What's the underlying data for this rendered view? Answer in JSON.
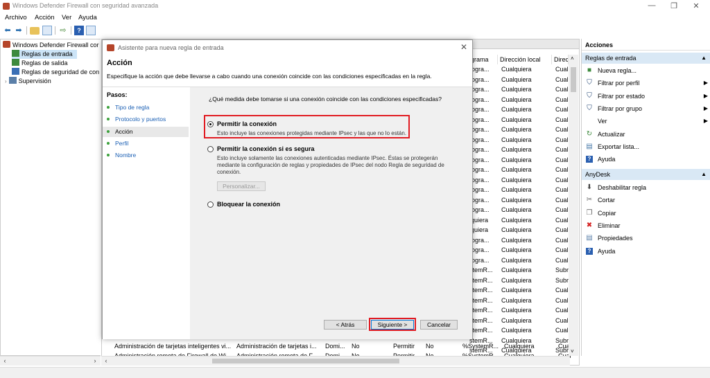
{
  "window": {
    "title": "Windows Defender Firewall con seguridad avanzada",
    "controls": [
      "—",
      "❐",
      "✕"
    ]
  },
  "menu": [
    "Archivo",
    "Acción",
    "Ver",
    "Ayuda"
  ],
  "toolbar": {
    "icons": [
      "back-arrow-icon",
      "forward-arrow-icon",
      "folder-up-icon",
      "view-icon",
      "export-icon",
      "help-icon",
      "properties-icon"
    ]
  },
  "tree": {
    "root": "Windows Defender Firewall cor",
    "items": [
      "Reglas de entrada",
      "Reglas de salida",
      "Reglas de seguridad de con",
      "Supervisión"
    ]
  },
  "list": {
    "columns": [
      "grama",
      "Dirección local",
      "Direc"
    ],
    "rows": [
      [
        "rogra...",
        "Cualquiera",
        "Cual"
      ],
      [
        "rogra...",
        "Cualquiera",
        "Cual"
      ],
      [
        "rogra...",
        "Cualquiera",
        "Cual"
      ],
      [
        "rogra...",
        "Cualquiera",
        "Cual"
      ],
      [
        "rogra...",
        "Cualquiera",
        "Cual"
      ],
      [
        "rogra...",
        "Cualquiera",
        "Cual"
      ],
      [
        "rogra...",
        "Cualquiera",
        "Cual"
      ],
      [
        "rogra...",
        "Cualquiera",
        "Cual"
      ],
      [
        "rogra...",
        "Cualquiera",
        "Cual"
      ],
      [
        "rogra...",
        "Cualquiera",
        "Cual"
      ],
      [
        "rogra...",
        "Cualquiera",
        "Cual"
      ],
      [
        "rogra...",
        "Cualquiera",
        "Cual"
      ],
      [
        "rogra...",
        "Cualquiera",
        "Cual"
      ],
      [
        "rogra...",
        "Cualquiera",
        "Cual"
      ],
      [
        "rogra...",
        "Cualquiera",
        "Cual"
      ],
      [
        "lquiera",
        "Cualquiera",
        "Cual"
      ],
      [
        "lquiera",
        "Cualquiera",
        "Cual"
      ],
      [
        "rogra...",
        "Cualquiera",
        "Cual"
      ],
      [
        "rogra...",
        "Cualquiera",
        "Cual"
      ],
      [
        "rogra...",
        "Cualquiera",
        "Cual"
      ],
      [
        "stemR...",
        "Cualquiera",
        "Subr"
      ],
      [
        "stemR...",
        "Cualquiera",
        "Subr"
      ],
      [
        "stemR...",
        "Cualquiera",
        "Cual"
      ],
      [
        "stemR...",
        "Cualquiera",
        "Cual"
      ],
      [
        "stemR...",
        "Cualquiera",
        "Cual"
      ],
      [
        "stemR...",
        "Cualquiera",
        "Cual"
      ],
      [
        "stemR...",
        "Cualquiera",
        "Cual"
      ],
      [
        "stemR...",
        "Cualquiera",
        "Subr"
      ],
      [
        "stemR...",
        "Cualquiera",
        "Subr"
      ]
    ],
    "bottom_rows": [
      [
        "Administración de tarjetas inteligentes vi...",
        "Administración de tarjetas i...",
        "Domi...",
        "No",
        "Permitir",
        "No",
        "%SystemR...",
        "Cualquiera",
        "Cual"
      ],
      [
        "Administración remota de Firewall de Wi...",
        "Administración remota de F...",
        "Domi...",
        "No",
        "Permitir",
        "No",
        "%SystemR...",
        "Cualquiera",
        "Cual"
      ]
    ]
  },
  "actions": {
    "title": "Acciones",
    "section1": {
      "title": "Reglas de entrada",
      "items": [
        {
          "icon": "new-rule-icon",
          "label": "Nueva regla...",
          "submenu": false
        },
        {
          "icon": "filter-icon",
          "label": "Filtrar por perfil",
          "submenu": true
        },
        {
          "icon": "filter-icon",
          "label": "Filtrar por estado",
          "submenu": true
        },
        {
          "icon": "filter-icon",
          "label": "Filtrar por grupo",
          "submenu": true
        },
        {
          "icon": "view-icon",
          "label": "Ver",
          "submenu": true
        },
        {
          "icon": "refresh-icon",
          "label": "Actualizar",
          "submenu": false
        },
        {
          "icon": "export-icon",
          "label": "Exportar lista...",
          "submenu": false
        },
        {
          "icon": "help-icon",
          "label": "Ayuda",
          "submenu": false
        }
      ]
    },
    "section2": {
      "title": "AnyDesk",
      "items": [
        {
          "icon": "disable-icon",
          "label": "Deshabilitar regla"
        },
        {
          "icon": "cut-icon",
          "label": "Cortar"
        },
        {
          "icon": "copy-icon",
          "label": "Copiar"
        },
        {
          "icon": "delete-icon",
          "label": "Eliminar"
        },
        {
          "icon": "properties-icon",
          "label": "Propiedades"
        },
        {
          "icon": "help-icon",
          "label": "Ayuda"
        }
      ]
    }
  },
  "wizard": {
    "title": "Asistente para nueva regla de entrada",
    "heading": "Acción",
    "description": "Especifique la acción que debe llevarse a cabo cuando una conexión coincide con las condiciones especificadas en la regla.",
    "steps_title": "Pasos:",
    "steps": [
      "Tipo de regla",
      "Protocolo y puertos",
      "Acción",
      "Perfil",
      "Nombre"
    ],
    "question": "¿Qué medida debe tomarse si una conexión coincide con las condiciones especificadas?",
    "options": [
      {
        "label": "Permitir la conexión",
        "desc": "Esto incluye las conexiones protegidas mediante IPsec y las que no lo están.",
        "selected": true
      },
      {
        "label": "Permitir la conexión si es segura",
        "desc": "Esto incluye solamente las conexiones autenticadas mediante IPsec. Éstas se protegerán mediante la configuración de reglas y propiedades de IPsec del nodo Regla de seguridad de conexión.",
        "selected": false
      },
      {
        "label": "Bloquear la conexión",
        "desc": "",
        "selected": false
      }
    ],
    "customize_button": "Personalizar...",
    "back_button": "< Atrás",
    "next_button": "Siguiente >",
    "cancel_button": "Cancelar"
  },
  "colors": {
    "highlight": "#e11b22",
    "accent": "#0078d7",
    "step_dot": "#3ca13c"
  }
}
